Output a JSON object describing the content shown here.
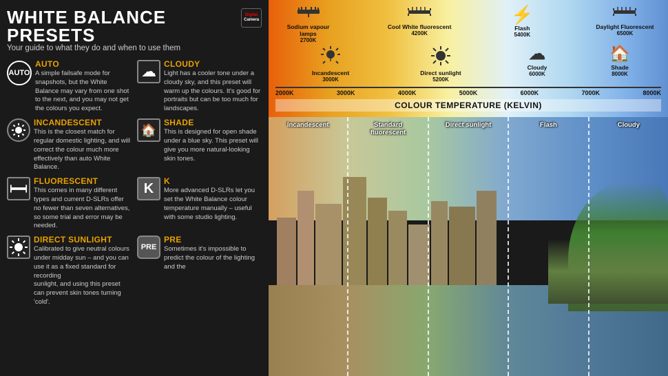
{
  "page": {
    "title": "WHITE BALANCE PRESETS",
    "subtitle": "Your guide to what they do and when to use them",
    "logo": "Digital Camera"
  },
  "presets": [
    {
      "id": "auto",
      "name": "AUTO",
      "icon": "AUTO",
      "icon_type": "circle-text",
      "description": "A simple failsafe mode for snapshots, but the White Balance may vary from one shot to the next, and you may not get the colours you expect."
    },
    {
      "id": "incandescent",
      "name": "Incandescent",
      "icon": "☀",
      "icon_type": "sun-lines",
      "description": "This is the closest match for regular domestic lighting, and will correct the colour much more effectively than auto White Balance."
    },
    {
      "id": "fluorescent",
      "name": "Fluorescent",
      "icon": "▬",
      "icon_type": "tube",
      "description": "This comes in many different types and current D-SLRs offer no fewer than seven alternatives, so some trial and error may be needed."
    },
    {
      "id": "direct-sunlight",
      "name": "Direct Sunlight",
      "icon": "☀",
      "icon_type": "sun",
      "description": "Calibrated to give neutral colours under midday sun – and you can use it as a fixed standard for recording"
    },
    {
      "id": "cloudy",
      "name": "Cloudy",
      "icon": "☁",
      "icon_type": "cloud",
      "description": "Light has a cooler tone under a cloudy sky, and this preset will warm up the colours. It's good for portraits but can be too much for landscapes."
    },
    {
      "id": "shade",
      "name": "Shade",
      "icon": "🏠",
      "icon_type": "house",
      "description": "This is designed for open shade under a blue sky. This preset will give you more natural-looking skin tones."
    },
    {
      "id": "k",
      "name": "K",
      "icon": "K",
      "icon_type": "letter",
      "description": "More advanced D-SLRs let you set the White Balance colour temperature manually – useful with some studio lighting."
    },
    {
      "id": "pre",
      "name": "PRE",
      "icon": "PRE",
      "icon_type": "badge",
      "description": "Sometimes it's impossible to predict the colour of the lighting and the"
    }
  ],
  "sunlight_col2_text": "sunlight, and using this preset can prevent skin tones turning 'cold'.",
  "temp_bar": {
    "title": "COLOUR TEMPERATURE (Kelvin)",
    "scale": [
      "2000K",
      "3000K",
      "4000K",
      "5000K",
      "6000K",
      "7000K",
      "8000K"
    ],
    "items": [
      {
        "name": "Sodium vapour lamps",
        "kelvin": "2700K",
        "icon": "lamp",
        "col": 1
      },
      {
        "name": "Incandescent",
        "kelvin": "3000K",
        "icon": "bulb",
        "col": 1
      },
      {
        "name": "Cool White fluorescent",
        "kelvin": "4200K",
        "icon": "tube",
        "col": 2
      },
      {
        "name": "Direct sunlight",
        "kelvin": "5200K",
        "icon": "sun",
        "col": 2
      },
      {
        "name": "Flash",
        "kelvin": "5400K",
        "icon": "flash",
        "col": 3
      },
      {
        "name": "Cloudy",
        "kelvin": "6000K",
        "icon": "cloud",
        "col": 3
      },
      {
        "name": "Daylight Fluorescent",
        "kelvin": "6500K",
        "icon": "tube",
        "col": 4
      },
      {
        "name": "Shade",
        "kelvin": "8000K",
        "icon": "house",
        "col": 4
      }
    ]
  },
  "photo": {
    "segments": [
      {
        "label": "Incandescent"
      },
      {
        "label": "Standard fluorescent"
      },
      {
        "label": "Direct sunlight"
      },
      {
        "label": "Flash"
      },
      {
        "label": "Cloudy"
      }
    ]
  },
  "colors": {
    "accent": "#e8a000",
    "background": "#1a1a1a",
    "text": "#cccccc"
  }
}
